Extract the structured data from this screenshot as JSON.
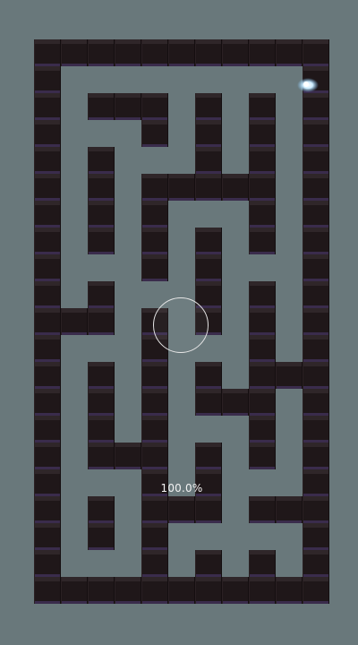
{
  "hud": {
    "progress_text": "100.0%",
    "progress_value": 100.0
  },
  "colors": {
    "background": "#69787b",
    "wall_top": "#2f2629",
    "wall_face": "#1f1719",
    "wall_edge": "#3a2c4c",
    "joystick_ring": "#e6e6e6",
    "marble": "#cfeeff"
  },
  "maze": {
    "grid": [
      "###########",
      "#.........#",
      "#.###.#.#.#",
      "#...#.#.#.#",
      "#.#...#.#.#",
      "#.#.#####.#",
      "#.#.#...#.#",
      "#.#.#.#.#.#",
      "#...#.#...#",
      "#.#...#.#.#",
      "###.#.#.#.#",
      "#...#...#.#",
      "#.#.#.#.###",
      "#.#.#.###.#",
      "#.#.#...#.#",
      "#.###.#.#.#",
      "#...#.#...#",
      "#.#.###.###",
      "#.#.#.....#",
      "#...#.#.#.#",
      "###########"
    ]
  },
  "icons": {
    "marble": "glowing-ball-icon",
    "joystick": "virtual-joystick-icon"
  }
}
